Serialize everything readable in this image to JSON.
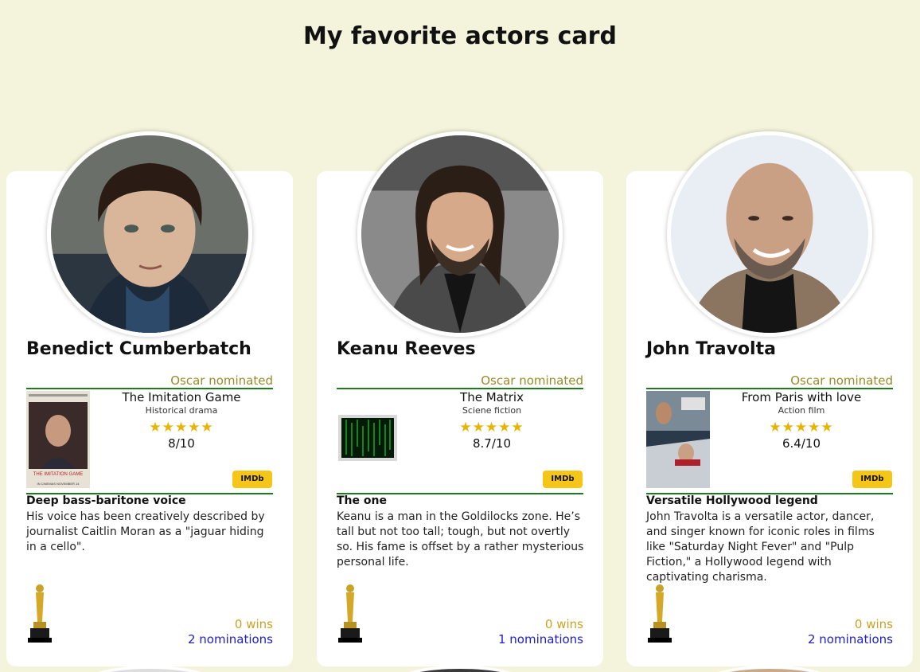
{
  "page": {
    "title": "My favorite actors card"
  },
  "actors": [
    {
      "name": "Benedict Cumberbatch",
      "oscar_status": "Oscar nominated",
      "movie": {
        "title": "The Imitation Game",
        "genre": "Historical drama",
        "stars": "★★★★★",
        "rating": "8/10"
      },
      "imdb_label": "IMDb",
      "trait_title": "Deep bass-baritone voice",
      "trait_text": "His voice has been creatively described by journalist Caitlin Moran as a \"jaguar hiding in a cello\".",
      "wins": "0 wins",
      "nominations": "2 nominations",
      "poster_text": "THE IMITATION GAME",
      "poster_subtext": "IN CINEMAS NOVEMBER 14"
    },
    {
      "name": "Keanu Reeves",
      "oscar_status": "Oscar nominated",
      "movie": {
        "title": "The Matrix",
        "genre": "Sciene fiction",
        "stars": "★★★★★",
        "rating": "8.7/10"
      },
      "imdb_label": "IMDb",
      "trait_title": "The one",
      "trait_text": "Keanu is a man in the Goldilocks zone. He’s tall but not too tall; tough, but not overtly so. His fame is offset by a rather mysterious personal life.",
      "wins": "0 wins",
      "nominations": "1 nominations"
    },
    {
      "name": "John Travolta",
      "oscar_status": "Oscar nominated",
      "movie": {
        "title": "From Paris with love",
        "genre": "Action film",
        "stars": "★★★★★",
        "rating": "6.4/10"
      },
      "imdb_label": "IMDb",
      "trait_title": "Versatile Hollywood legend",
      "trait_text": "John Travolta is a versatile actor, dancer, and singer known for iconic roles in films like \"Saturday Night Fever\" and \"Pulp Fiction,\" a Hollywood legend with captivating charisma.",
      "wins": "0 wins",
      "nominations": "2 nominations"
    }
  ],
  "colors": {
    "background": "#f4f4dc",
    "oscar_status": "#9a8a2a",
    "divider": "#1e7a1e",
    "stars": "#e8b400",
    "imdb": "#f5c518",
    "wins": "#c9a227",
    "nominations": "#2020c8"
  }
}
